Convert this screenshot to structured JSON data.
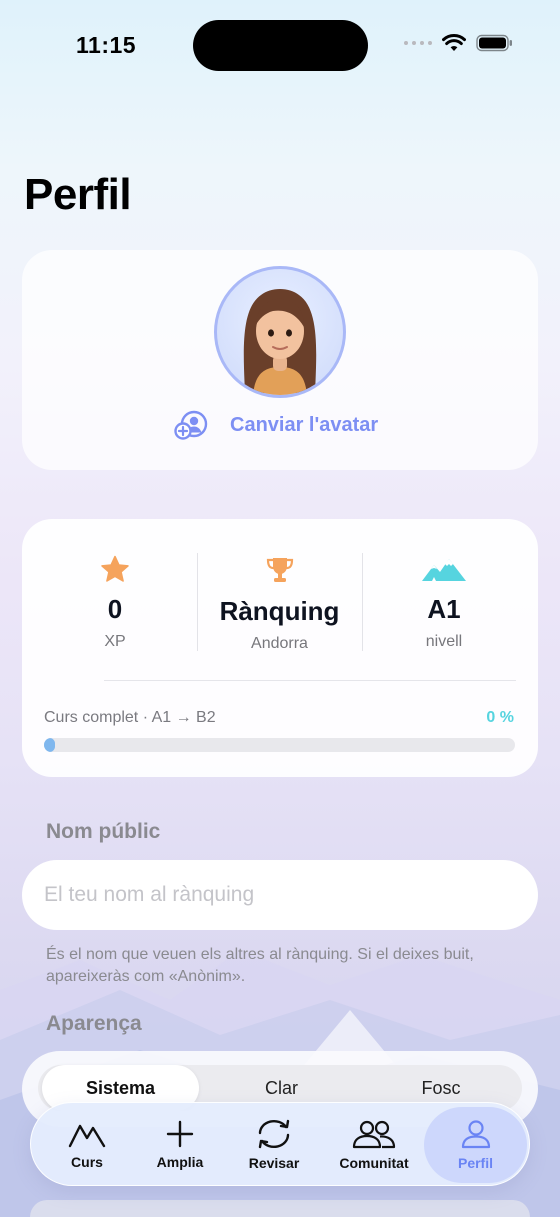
{
  "status_bar": {
    "time": "11:15"
  },
  "page": {
    "title": "Perfil"
  },
  "avatar": {
    "change_label": "Canviar l'avatar"
  },
  "stats": [
    {
      "icon": "star-icon",
      "value": "0",
      "label": "XP",
      "color": "#f5a35c"
    },
    {
      "icon": "trophy-icon",
      "value": "Rànquing",
      "label": "Andorra",
      "color": "#f5a35c"
    },
    {
      "icon": "mountain-icon",
      "value": "A1",
      "label": "nivell",
      "color": "#56d4df"
    }
  ],
  "course": {
    "label": "Curs complet · A1 → B2",
    "percent_label": "0 %",
    "progress": 0
  },
  "public_name": {
    "section_label": "Nom públic",
    "value": "",
    "placeholder": "El teu nom al rànquing",
    "helper": "És el nom que veuen els altres al rànquing. Si el deixes buit, apareixeràs com «Anònim»."
  },
  "appearance": {
    "section_label": "Aparença",
    "options": [
      "Sistema",
      "Clar",
      "Fosc"
    ],
    "selected": "Sistema"
  },
  "tabbar": {
    "active": "Perfil",
    "items": [
      {
        "label": "Curs",
        "icon": "mountain-outline-icon"
      },
      {
        "label": "Amplia",
        "icon": "plus-icon"
      },
      {
        "label": "Revisar",
        "icon": "refresh-icon"
      },
      {
        "label": "Comunitat",
        "icon": "people-icon"
      },
      {
        "label": "Perfil",
        "icon": "person-icon"
      }
    ]
  },
  "colors": {
    "accent": "#7d8ff3",
    "orange": "#f5a35c",
    "teal": "#56d4df",
    "active_tab": "#6a84f4"
  }
}
